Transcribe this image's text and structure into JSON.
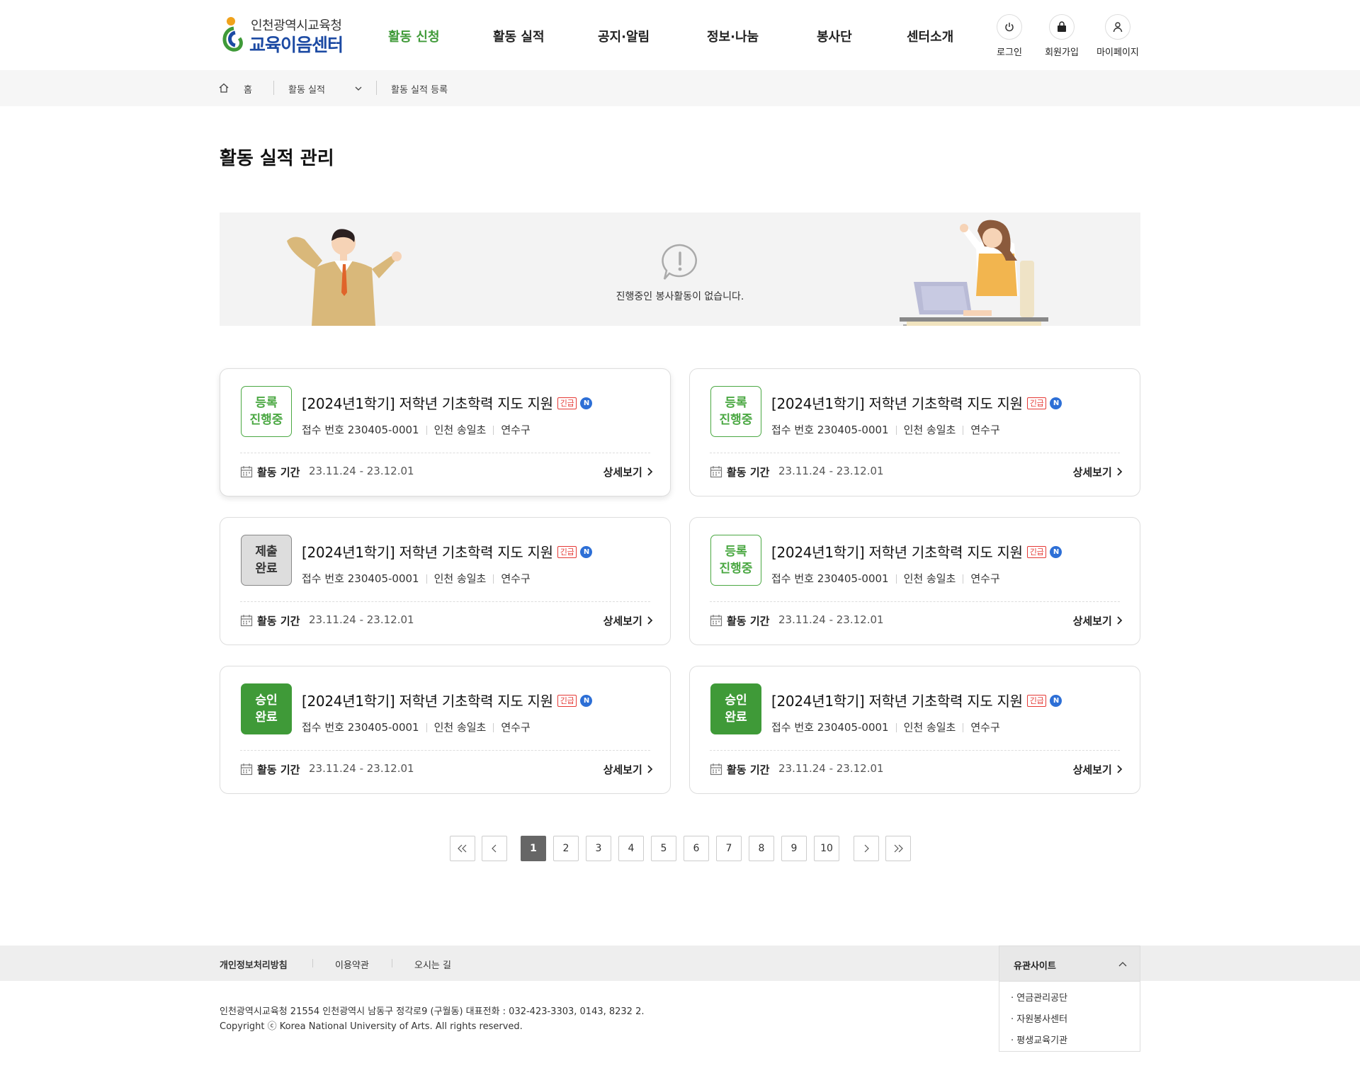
{
  "header": {
    "logo_top": "인천광역시교육청",
    "logo_main": "교육이음센터",
    "nav": [
      "활동 신청",
      "활동 실적",
      "공지·알림",
      "정보·나눔",
      "봉사단",
      "센터소개"
    ],
    "util": {
      "login": "로그인",
      "join": "회원가입",
      "mypage": "마이페이지"
    }
  },
  "breadcrumb": {
    "home": "홈",
    "level1": "활동 실적",
    "level2": "활동 실적 등록"
  },
  "page_title": "활동 실적 관리",
  "banner": {
    "message": "진행중인 봉사활동이 없습니다."
  },
  "cards": [
    {
      "status_line1": "등록",
      "status_line2": "진행중",
      "status_type": "open",
      "title": "[2024년1학기] 저학년 기초학력 지도 지원",
      "urgent": "긴급",
      "new": "N",
      "receipt": "접수 번호 230405-0001",
      "school": "인천 송일초",
      "district": "연수구",
      "period_label": "활동 기간",
      "period": "23.11.24 - 23.12.01",
      "detail": "상세보기"
    },
    {
      "status_line1": "등록",
      "status_line2": "진행중",
      "status_type": "open",
      "title": "[2024년1학기] 저학년 기초학력 지도 지원",
      "urgent": "긴급",
      "new": "N",
      "receipt": "접수 번호 230405-0001",
      "school": "인천 송일초",
      "district": "연수구",
      "period_label": "활동 기간",
      "period": "23.11.24 - 23.12.01",
      "detail": "상세보기"
    },
    {
      "status_line1": "제출",
      "status_line2": "완료",
      "status_type": "submitted",
      "title": "[2024년1학기] 저학년 기초학력 지도 지원",
      "urgent": "긴급",
      "new": "N",
      "receipt": "접수 번호 230405-0001",
      "school": "인천 송일초",
      "district": "연수구",
      "period_label": "활동 기간",
      "period": "23.11.24 - 23.12.01",
      "detail": "상세보기"
    },
    {
      "status_line1": "등록",
      "status_line2": "진행중",
      "status_type": "open",
      "title": "[2024년1학기] 저학년 기초학력 지도 지원",
      "urgent": "긴급",
      "new": "N",
      "receipt": "접수 번호 230405-0001",
      "school": "인천 송일초",
      "district": "연수구",
      "period_label": "활동 기간",
      "period": "23.11.24 - 23.12.01",
      "detail": "상세보기"
    },
    {
      "status_line1": "승인",
      "status_line2": "완료",
      "status_type": "approved",
      "title": "[2024년1학기] 저학년 기초학력 지도 지원",
      "urgent": "긴급",
      "new": "N",
      "receipt": "접수 번호 230405-0001",
      "school": "인천 송일초",
      "district": "연수구",
      "period_label": "활동 기간",
      "period": "23.11.24 - 23.12.01",
      "detail": "상세보기"
    },
    {
      "status_line1": "승인",
      "status_line2": "완료",
      "status_type": "approved",
      "title": "[2024년1학기] 저학년 기초학력 지도 지원",
      "urgent": "긴급",
      "new": "N",
      "receipt": "접수 번호 230405-0001",
      "school": "인천 송일초",
      "district": "연수구",
      "period_label": "활동 기간",
      "period": "23.11.24 - 23.12.01",
      "detail": "상세보기"
    }
  ],
  "pagination": {
    "pages": [
      "1",
      "2",
      "3",
      "4",
      "5",
      "6",
      "7",
      "8",
      "9",
      "10"
    ],
    "current": "1"
  },
  "footer": {
    "links": [
      "개인정보처리방침",
      "이용약관",
      "오시는 길"
    ],
    "address": "인천광역시교육청 21554 인천광역시 남동구 정각로9 (구월동) 대표전화 : 032-423-3303, 0143, 8232 2.",
    "copyright": "Copyright ⓒ Korea National University of Arts. All rights reserved.",
    "related_title": "유관사이트",
    "related_items": [
      "· 연금관리공단",
      "· 자원봉사센터",
      "· 평생교육기관"
    ]
  },
  "colors": {
    "brand_green": "#3f9a38",
    "brand_blue": "#1c4aa3",
    "urgent_red": "#e53935",
    "new_blue": "#2d6fd6"
  }
}
